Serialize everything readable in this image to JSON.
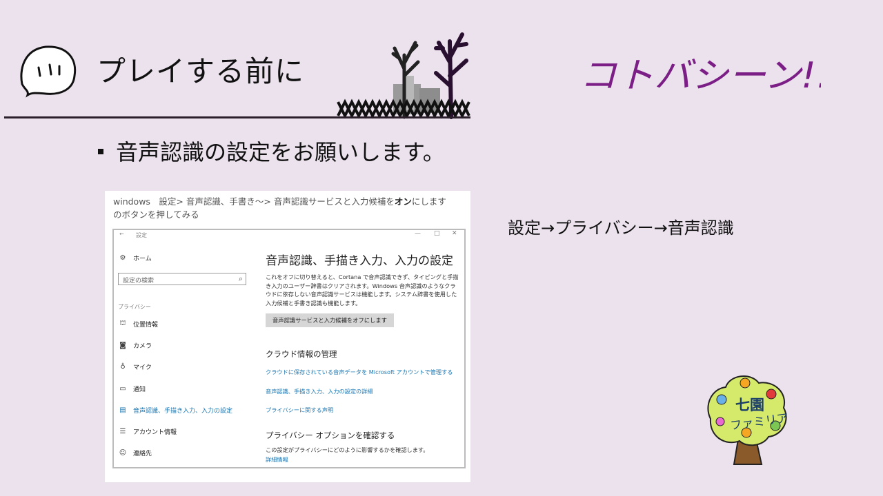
{
  "slide": {
    "title": "プレイする前に",
    "brand": "コトバシーン!!!",
    "bullet": "音声認識の設定をお願いします。",
    "path_note": "設定→プライバシー→音声認識"
  },
  "screenshot": {
    "caption_prefix": "windows　設定> 音声認識、手書き～> 音声認識サービスと入力候補を",
    "caption_bold": "オン",
    "caption_suffix": "にします　のボタンを押してみる",
    "window_title": "設定",
    "sidebar": {
      "home": "ホーム",
      "search_placeholder": "設定の検索",
      "section": "プライバシー",
      "items": [
        {
          "label": "位置情報",
          "icon": "location-icon"
        },
        {
          "label": "カメラ",
          "icon": "camera-icon"
        },
        {
          "label": "マイク",
          "icon": "microphone-icon"
        },
        {
          "label": "通知",
          "icon": "notification-icon"
        },
        {
          "label": "音声認識、手描き入力、入力の設定",
          "icon": "clipboard-icon",
          "active": true
        },
        {
          "label": "アカウント情報",
          "icon": "account-info-icon"
        },
        {
          "label": "連絡先",
          "icon": "contacts-icon"
        }
      ]
    },
    "main": {
      "heading": "音声認識、手描き入力、入力の設定",
      "description": "これをオフに切り替えると、Cortana で音声認識できず、タイピングと手描き入力のユーザー辞書はクリアされます。Windows 音声認識のようなクラウドに依存しない音声認識サービスは機能します。システム辞書を使用した入力候補と手書き認識も機能します。",
      "button": "音声認識サービスと入力候補をオフにします",
      "cloud_heading": "クラウド情報の管理",
      "links": [
        "クラウドに保存されている音声データを Microsoft アカウントで管理する",
        "音声認識、手描き入力、入力の設定の詳細",
        "プライバシーに関する声明"
      ],
      "privacy_heading": "プライバシー オプションを確認する",
      "privacy_desc": "この設定がプライバシーにどのように影響するかを確認します。",
      "privacy_link": "詳細情報"
    }
  },
  "logo": {
    "line1": "七園",
    "line2": "ファミリア"
  },
  "colors": {
    "background": "#ece2ee",
    "brand": "#7b1e86",
    "link": "#1a78b4"
  }
}
